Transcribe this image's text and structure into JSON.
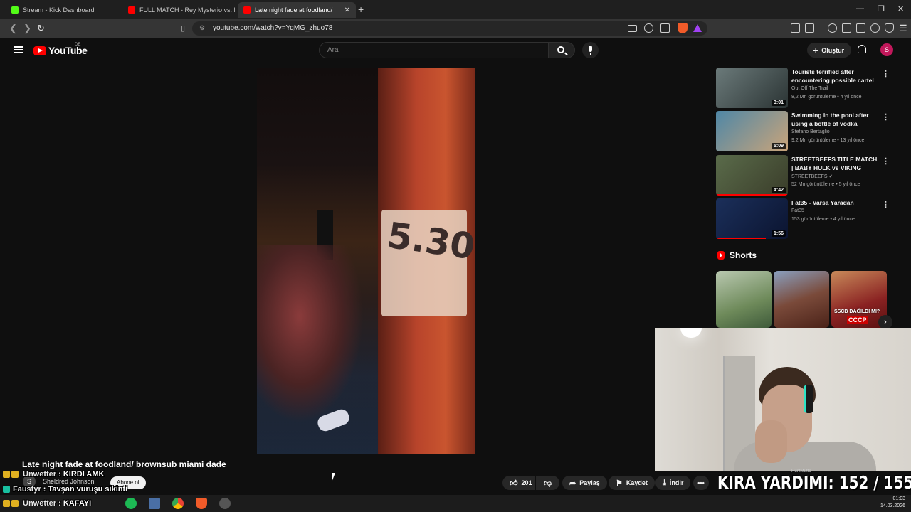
{
  "browser": {
    "tabs": [
      {
        "title": "Stream - Kick Dashboard",
        "favicon_color": "#53fc18"
      },
      {
        "title": "FULL MATCH - Rey Mysterio vs. Batis",
        "favicon_color": "#ff0000"
      },
      {
        "title": "Late night fade at foodland/",
        "favicon_color": "#ff0000",
        "active": true
      }
    ],
    "url": "youtube.com/watch?v=YqMG_zhuo78",
    "new_tab_symbol": "+"
  },
  "youtube": {
    "logo_text": "YouTube",
    "country_code": "DE",
    "search_placeholder": "Ara",
    "create_label": "Oluştur",
    "avatar_letter": "S"
  },
  "video": {
    "title": "Late night fade at foodland/ brownsub miami dade",
    "sign_number": "5.30",
    "like_count": "201",
    "share_label": "Paylaş",
    "save_label": "Kaydet",
    "download_label": "İndir"
  },
  "channel": {
    "name": "Sheldred Johnson",
    "avatar_letter": "S",
    "subscribe_label": "Abone ol"
  },
  "recommendations": [
    {
      "title": "Tourists terrified after encountering possible cartel ...",
      "channel": "Out Off The Trail",
      "meta": "8,2 Mn görüntüleme • 4 yıl önce",
      "duration": "3:01",
      "thumb_color": "#6b7a7a"
    },
    {
      "title": "Swimming in the pool after using a bottle of vodka",
      "channel": "Stefano Bertaglio",
      "meta": "9,2 Mn görüntüleme • 13 yıl önce",
      "duration": "5:09",
      "thumb_color": "#4f87a6"
    },
    {
      "title": "STREETBEEFS TITLE MATCH | BABY HULK vs VIKING",
      "channel": "STREETBEEFS ✓",
      "meta": "52 Mn görüntüleme • 5 yıl önce",
      "duration": "4:42",
      "thumb_color": "#5a6b4a"
    },
    {
      "title": "Fat35 - Varsa Yaradan",
      "channel": "Fat35",
      "meta": "153 görüntüleme • 4 yıl önce",
      "duration": "1:56",
      "thumb_color": "#1b2f5a"
    }
  ],
  "shorts": {
    "title": "Shorts",
    "items": [
      {
        "color": "#6e8a5a",
        "caption": ""
      },
      {
        "color": "#7a4a3a",
        "caption": ""
      },
      {
        "color": "#8a2222",
        "caption": "SSCB DAĞILDI MI?",
        "caption2": "CCCP"
      }
    ]
  },
  "chat_overlay": [
    {
      "user": "Unwetter",
      "message": "KIRDI AMK",
      "badge_color": "#e0b020"
    },
    {
      "user": "Faustyr",
      "message": "Tavşan vuruşu sikinti",
      "badge_color": "#18c0a0"
    },
    {
      "user": "Unwetter",
      "message": "KAFAYI",
      "badge_color": "#e0b020"
    }
  ],
  "stream_overlay": {
    "counter_text": "KIRA YARDIMI: 152 / 155",
    "cam_caption": "HuntMutto"
  },
  "taskbar": {
    "apps": [
      {
        "name": "spotify",
        "color": "#1db954"
      },
      {
        "name": "calculator",
        "color": "#4a6fa5"
      },
      {
        "name": "chrome",
        "color": "#4285f4"
      },
      {
        "name": "brave",
        "color": "#f15b29"
      },
      {
        "name": "obs",
        "color": "#555555"
      }
    ],
    "time": "01:03",
    "date": "14.03.2026"
  }
}
